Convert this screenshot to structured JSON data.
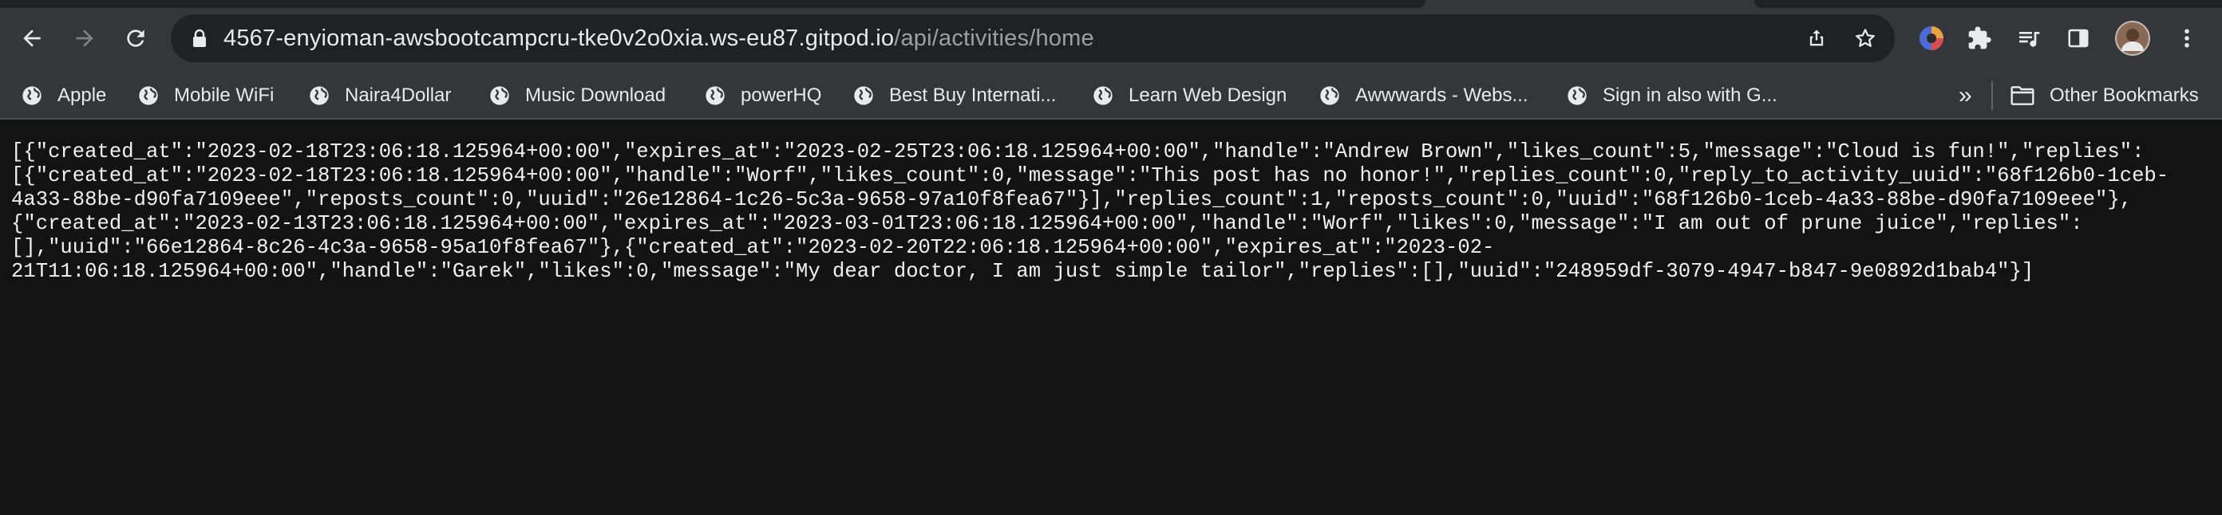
{
  "address_bar": {
    "host": "4567-enyioman-awsbootcampcru-tke0v2o0xia.ws-eu87.gitpod.io",
    "path": "/api/activities/home"
  },
  "bookmarks": [
    {
      "label": "Apple"
    },
    {
      "label": "Mobile WiFi"
    },
    {
      "label": "Naira4Dollar"
    },
    {
      "label": "Music Download"
    },
    {
      "label": "powerHQ"
    },
    {
      "label": "Best Buy Internati..."
    },
    {
      "label": "Learn Web Design"
    },
    {
      "label": "Awwwards - Webs..."
    },
    {
      "label": "Sign in also with G..."
    }
  ],
  "overflow_label": "»",
  "other_bookmarks_label": "Other Bookmarks",
  "json_lines": [
    "[{\"created_at\":\"2023-02-18T23:06:18.125964+00:00\",\"expires_at\":\"2023-02-25T23:06:18.125964+00:00\",\"handle\":\"Andrew Brown\",\"likes_count\":5,\"message\":\"Cloud is fun!\",\"replies\":",
    "[{\"created_at\":\"2023-02-18T23:06:18.125964+00:00\",\"handle\":\"Worf\",\"likes_count\":0,\"message\":\"This post has no honor!\",\"replies_count\":0,\"reply_to_activity_uuid\":\"68f126b0-1ceb-",
    "4a33-88be-d90fa7109eee\",\"reposts_count\":0,\"uuid\":\"26e12864-1c26-5c3a-9658-97a10f8fea67\"}],\"replies_count\":1,\"reposts_count\":0,\"uuid\":\"68f126b0-1ceb-4a33-88be-d90fa7109eee\"},",
    "{\"created_at\":\"2023-02-13T23:06:18.125964+00:00\",\"expires_at\":\"2023-03-01T23:06:18.125964+00:00\",\"handle\":\"Worf\",\"likes\":0,\"message\":\"I am out of prune juice\",\"replies\":",
    "[],\"uuid\":\"66e12864-8c26-4c3a-9658-95a10f8fea67\"},{\"created_at\":\"2023-02-20T22:06:18.125964+00:00\",\"expires_at\":\"2023-02-",
    "21T11:06:18.125964+00:00\",\"handle\":\"Garek\",\"likes\":0,\"message\":\"My dear doctor, I am just simple tailor\",\"replies\":[],\"uuid\":\"248959df-3079-4947-b847-9e0892d1bab4\"}]"
  ]
}
